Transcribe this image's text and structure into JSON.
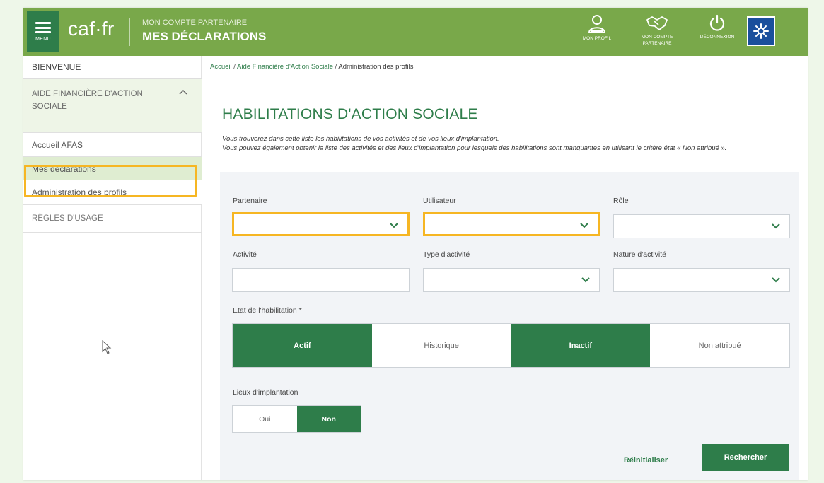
{
  "colors": {
    "header_bg": "#79a84a",
    "primary_green": "#2e7d4a",
    "highlight": "#f6b623",
    "active_nav": "#dfedd1"
  },
  "header": {
    "menu_label": "MENU",
    "logo": "caf·fr",
    "subtitle": "MON COMPTE PARTENAIRE",
    "title": "MES DÉCLARATIONS",
    "actions": [
      {
        "label": "MON PROFIL",
        "icon": "user-icon"
      },
      {
        "label": "MON COMPTE PARTENAIRE",
        "icon": "handshake-icon"
      },
      {
        "label": "DÉCONNEXION",
        "icon": "power-icon"
      }
    ],
    "org_logo_icon": "cnaf-logo-icon"
  },
  "sidebar": {
    "items": [
      {
        "label": "BIENVENUE"
      },
      {
        "label": "AIDE FINANCIÈRE D'ACTION SOCIALE",
        "expanded": true
      },
      {
        "label": "Accueil AFAS"
      },
      {
        "label": "Mes déclarations",
        "active": true
      },
      {
        "label": "Administration des profils",
        "highlighted": true
      },
      {
        "label": "RÈGLES D'USAGE"
      }
    ]
  },
  "breadcrumb": {
    "items": [
      "Accueil",
      "Aide Financière d'Action Sociale",
      "Administration des profils"
    ]
  },
  "main": {
    "title": "HABILITATIONS D'ACTION SOCIALE",
    "intro_line1": "Vous trouverez dans cette liste les habilitations de vos activités et de vos lieux d'implantation.",
    "intro_line2": "Vous pouvez également obtenir la liste des activités et des lieux d'implantation pour lesquels des habilitations sont manquantes en utilisant le critère état « Non attribué »."
  },
  "filters": {
    "partenaire": {
      "label": "Partenaire",
      "value": ""
    },
    "utilisateur": {
      "label": "Utilisateur",
      "value": ""
    },
    "role": {
      "label": "Rôle",
      "value": ""
    },
    "activite": {
      "label": "Activité",
      "value": ""
    },
    "type_activite": {
      "label": "Type d'activité",
      "value": ""
    },
    "nature_activite": {
      "label": "Nature d'activité",
      "value": ""
    },
    "etat": {
      "label": "Etat de l'habilitation *",
      "options": [
        {
          "label": "Actif",
          "selected": true
        },
        {
          "label": "Historique",
          "selected": false
        },
        {
          "label": "Inactif",
          "selected": true
        },
        {
          "label": "Non attribué",
          "selected": false
        }
      ]
    },
    "lieux": {
      "label": "Lieux d'implantation",
      "options": [
        {
          "label": "Oui",
          "selected": false
        },
        {
          "label": "Non",
          "selected": true
        }
      ]
    },
    "reset_label": "Réinitialiser",
    "search_label": "Rechercher"
  }
}
